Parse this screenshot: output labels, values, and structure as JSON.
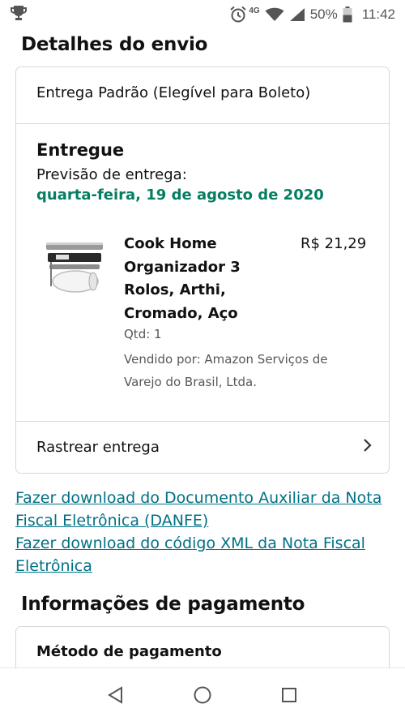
{
  "status_bar": {
    "network": "4G",
    "battery": "50%",
    "time": "11:42"
  },
  "shipping": {
    "title": "Detalhes do envio",
    "type": "Entrega Padrão (Elegível para Boleto)",
    "status": "Entregue",
    "forecast_label": "Previsão de entrega:",
    "forecast_date": "quarta-feira, 19 de agosto de 2020",
    "product": {
      "name": "Cook Home Organizador 3 Rolos, Arthi, Cromado, Aço",
      "price": "R$ 21,29",
      "qty": "Qtd: 1",
      "seller": "Vendido por: Amazon Serviços de Varejo do Brasil, Ltda.",
      "image_label": "ROLL"
    },
    "track_label": "Rastrear entrega"
  },
  "links": {
    "danfe": "Fazer download do Documento Auxiliar da Nota Fiscal Eletrônica (DANFE)",
    "xml": "Fazer download do código XML da Nota Fiscal Eletrônica"
  },
  "payment": {
    "title": "Informações de pagamento",
    "method_label": "Método de pagamento"
  },
  "icons": {
    "trophy": "trophy-icon",
    "alarm": "alarm-icon",
    "wifi": "wifi-icon",
    "signal": "signal-icon",
    "battery": "battery-icon",
    "chevron": "chevron-right-icon",
    "back": "back-icon",
    "home": "home-icon",
    "recents": "recents-icon"
  },
  "colors": {
    "accent_green": "#067d62",
    "link": "#007185",
    "border": "#d5d9d9"
  }
}
